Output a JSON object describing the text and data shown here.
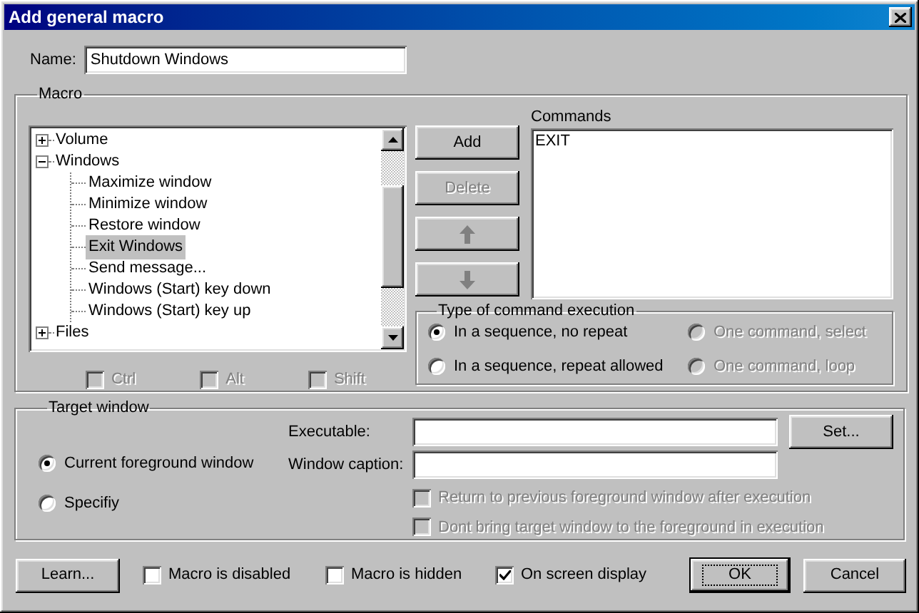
{
  "window": {
    "title": "Add general macro"
  },
  "name": {
    "label": "Name:",
    "value": "Shutdown Windows"
  },
  "macro": {
    "title": "Macro",
    "tree": [
      {
        "label": "Volume",
        "expanded": false
      },
      {
        "label": "Windows",
        "expanded": true,
        "children": [
          {
            "label": "Maximize window",
            "selected": false
          },
          {
            "label": "Minimize window",
            "selected": false
          },
          {
            "label": "Restore window",
            "selected": false
          },
          {
            "label": "Exit Windows",
            "selected": true
          },
          {
            "label": "Send message...",
            "selected": false
          },
          {
            "label": "Windows (Start) key down",
            "selected": false
          },
          {
            "label": "Windows (Start) key up",
            "selected": false
          }
        ]
      },
      {
        "label": "Files",
        "expanded": false
      }
    ],
    "modifiers": [
      {
        "label": "Ctrl",
        "checked": false,
        "disabled": true
      },
      {
        "label": "Alt",
        "checked": false,
        "disabled": true
      },
      {
        "label": "Shift",
        "checked": false,
        "disabled": true
      }
    ],
    "buttons": [
      {
        "kind": "text",
        "label": "Add",
        "disabled": false
      },
      {
        "kind": "text",
        "label": "Delete",
        "disabled": true
      },
      {
        "kind": "up",
        "disabled": true
      },
      {
        "kind": "down",
        "disabled": true
      }
    ],
    "commands": {
      "label": "Commands",
      "items": [
        "EXIT"
      ]
    },
    "execution": {
      "title": "Type of command execution",
      "options": [
        {
          "label": "In a sequence, no repeat",
          "selected": true,
          "disabled": false
        },
        {
          "label": "One command, select",
          "selected": false,
          "disabled": true
        },
        {
          "label": "In a sequence, repeat allowed",
          "selected": false,
          "disabled": false
        },
        {
          "label": "One command, loop",
          "selected": false,
          "disabled": true
        }
      ]
    }
  },
  "target": {
    "title": "Target window",
    "options": [
      {
        "label": "Current foreground window",
        "selected": true,
        "disabled": false
      },
      {
        "label": "Specifiy",
        "selected": false,
        "disabled": false
      }
    ],
    "executable": {
      "label": "Executable:"
    },
    "caption": {
      "label": "Window caption:"
    },
    "set_button": "Set...",
    "checks": [
      {
        "label": "Return to previous foreground window after execution",
        "checked": false,
        "disabled": true
      },
      {
        "label": "Dont bring target window to the foreground in execution",
        "checked": false,
        "disabled": true
      }
    ]
  },
  "footer": {
    "learn": "Learn...",
    "checks": [
      {
        "label": "Macro is disabled",
        "checked": false,
        "disabled": false
      },
      {
        "label": "Macro is hidden",
        "checked": false,
        "disabled": false
      },
      {
        "label": "On screen display",
        "checked": true,
        "disabled": false
      }
    ],
    "ok": "OK",
    "cancel": "Cancel"
  }
}
